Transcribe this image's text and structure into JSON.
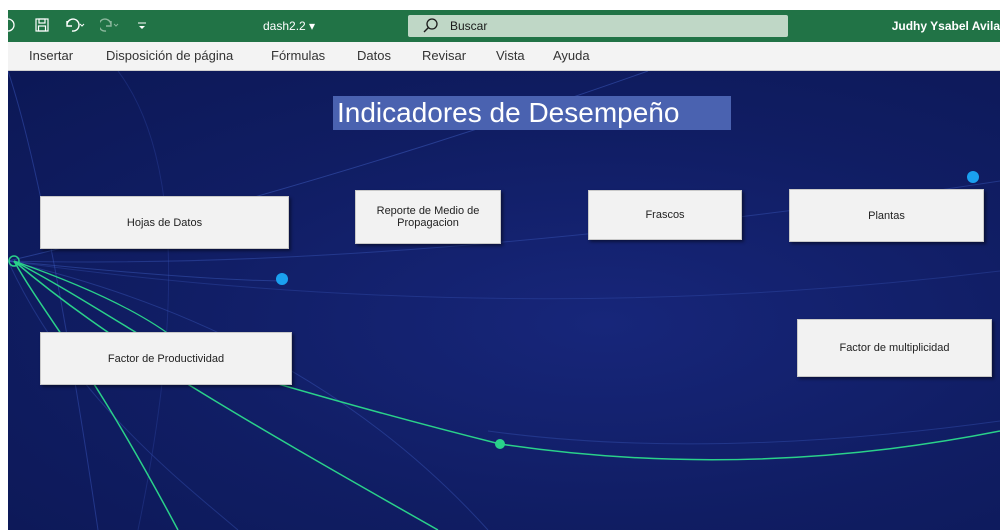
{
  "titlebar": {
    "doc_name": "dash2.2 ▾",
    "search_label": "Buscar",
    "user_name": "Judhy Ysabel Avila",
    "accent_color": "#217346"
  },
  "menu": {
    "items": [
      "Insertar",
      "Disposición de página",
      "Fórmulas",
      "Datos",
      "Revisar",
      "Vista",
      "Ayuda"
    ]
  },
  "sheet": {
    "title": "Indicadores de Desempeño",
    "buttons": {
      "hojas": "Hojas de Datos",
      "reporte": "Reporte de Medio de Propagacion",
      "frascos": "Frascos",
      "plantas": "Plantas",
      "productividad": "Factor de Productividad",
      "multiplicidad": "Factor de multiplicidad"
    },
    "background_color": "#101d63",
    "line_color": "#2ad18a"
  }
}
